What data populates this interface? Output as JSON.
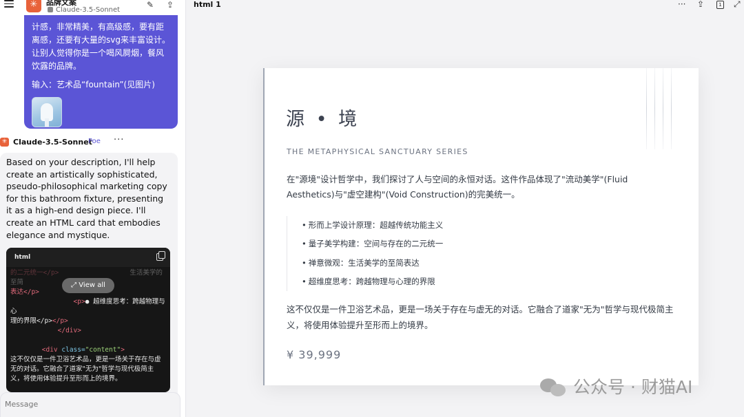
{
  "chat": {
    "header": {
      "bot_title": "品牌文案",
      "bot_subtitle": "Claude-3.5-Sonnet"
    },
    "user_message": {
      "lines": [
        "计感，非常精美，有高级感，要有距离感，还要有大量的svg来丰富设计。让别人觉得你是一个喝风屙烟，餐风饮露的品牌。"
      ],
      "input_line": "输入：艺术品“fountain”(见图片)"
    },
    "bot_row": {
      "name": "Claude-3.5-Sonnet",
      "badge": "Poe",
      "more": "···"
    },
    "bot_reply": {
      "text": "Based on your description, I'll help create an artistically sophisticated, pseudo-philosophical marketing copy for this bathroom fixture, presenting it as a high-end design piece. I'll create an HTML card that embodies elegance and mystique."
    },
    "code_card": {
      "lang": "html",
      "view_all": "View all",
      "line1": "的二元统一</p>",
      "line1_tail": "生活美学的至简",
      "line2": "表达</p>",
      "line3_tag": "<p>",
      "line3_text": "● 超维度思考：跨越物理与心",
      "line4": "理的界限</p>",
      "line5": "</div>",
      "line6_open": "<div ",
      "line6_attr": "class=",
      "line6_str": "\"content\"",
      "line6_close": ">",
      "line7": "这不仅仅是一件卫浴艺术品，更是一场关于存在与虚无的对话。它融合了道家\"无为\"哲学与现代极简主义，将使用体验提升至形而上的境界。"
    },
    "composer": {
      "placeholder": "Message"
    }
  },
  "preview": {
    "title": "html 1",
    "more": "···",
    "page_number": "1"
  },
  "card": {
    "title": "源 • 境",
    "subtitle": "THE METAPHYSICAL SANCTUARY SERIES",
    "intro": "在\"源境\"设计哲学中，我们探讨了人与空间的永恒对话。这件作品体现了\"流动美学\"(Fluid Aesthetics)与\"虚空建构\"(Void Construction)的完美统一。",
    "features": [
      "形而上学设计原理：超越传统功能主义",
      "量子美学构建：空间与存在的二元统一",
      "禅意微观：生活美学的至简表达",
      "超维度思考：跨越物理与心理的界限"
    ],
    "closing": "这不仅仅是一件卫浴艺术品，更是一场关于存在与虚无的对话。它融合了道家\"无为\"哲学与现代极简主义，将使用体验提升至形而上的境界。",
    "price": "¥ 39,999"
  },
  "watermark": {
    "text": "公众号 · 财猫AI"
  },
  "colors": {
    "user_bubble": "#5b55d6",
    "bot_avatar": "#e8623a",
    "card_text": "#333a44",
    "card_title": "#3c4250"
  }
}
